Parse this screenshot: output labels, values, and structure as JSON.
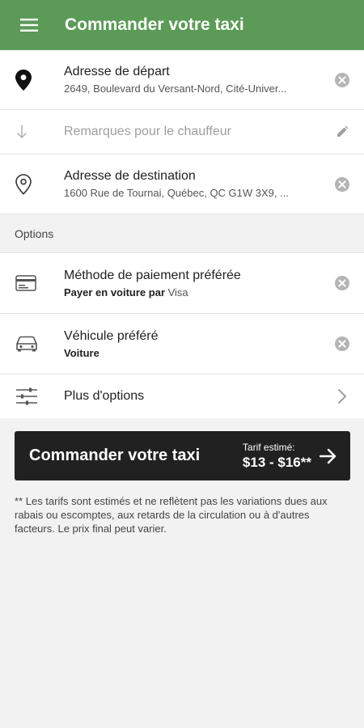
{
  "appbar": {
    "title": "Commander votre taxi",
    "menu_icon": "hamburger-menu-icon",
    "color": "#5b9a57"
  },
  "pickup": {
    "label": "Adresse de départ",
    "value": "2649, Boulevard du Versant-Nord, Cité-Univer..."
  },
  "remarks": {
    "placeholder": "Remarques pour le chauffeur"
  },
  "destination": {
    "label": "Adresse de destination",
    "value": "1600 Rue de Tournai, Québec, QC G1W 3X9, ..."
  },
  "options": {
    "section_label": "Options",
    "payment": {
      "label": "Méthode de paiement préférée",
      "value_bold": "Payer en voiture par",
      "value_rest": " Visa"
    },
    "vehicle": {
      "label": "Véhicule préféré",
      "value": "Voiture"
    },
    "more": {
      "label": "Plus d'options"
    }
  },
  "order_button": {
    "label": "Commander votre taxi",
    "fare_caption": "Tarif estimé:",
    "fare_value": "$13 - $16**"
  },
  "disclaimer": "** Les tarifs sont estimés et ne reflètent pas les variations dues aux rabais ou escomptes, aux retards de la circulation ou à d'autres facteurs. Le prix final peut varier."
}
